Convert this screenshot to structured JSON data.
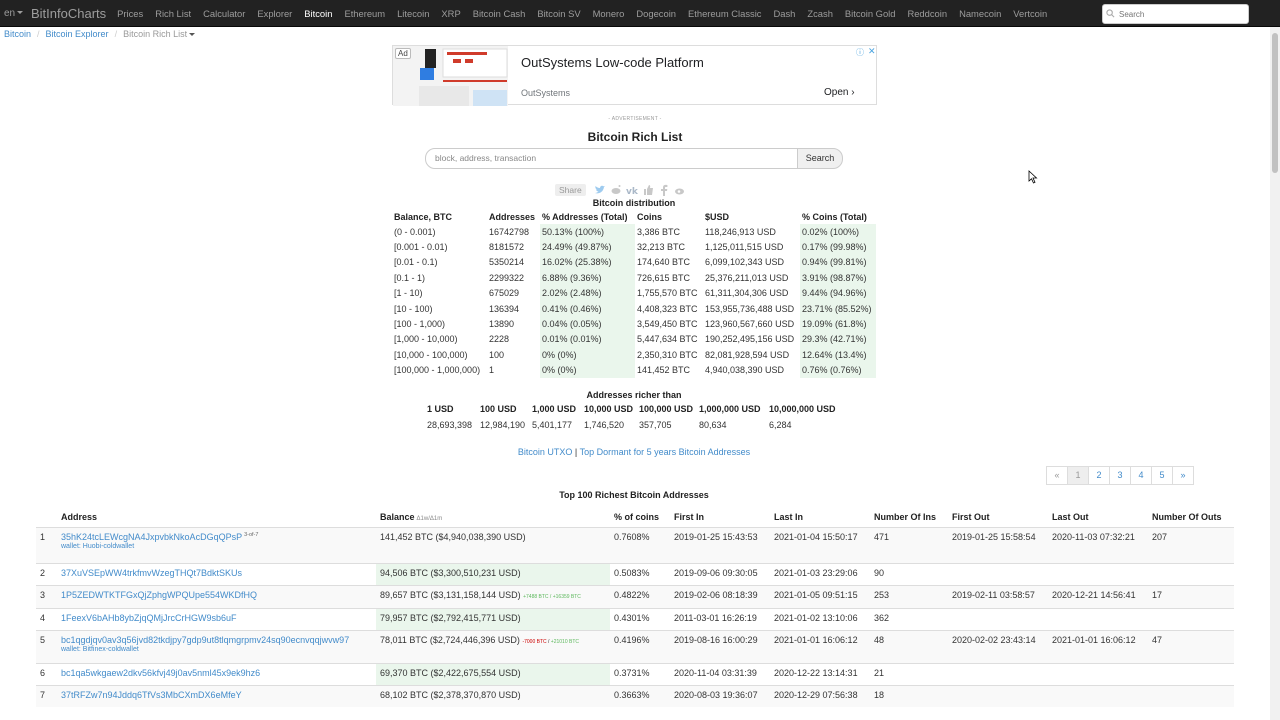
{
  "nav": {
    "lang": "en",
    "brand": "BitInfoCharts",
    "items": [
      {
        "label": "Prices",
        "active": false
      },
      {
        "label": "Rich List",
        "active": false
      },
      {
        "label": "Calculator",
        "active": false
      },
      {
        "label": "Explorer",
        "active": false
      },
      {
        "label": "Bitcoin",
        "active": true
      },
      {
        "label": "Ethereum",
        "active": false
      },
      {
        "label": "Litecoin",
        "active": false
      },
      {
        "label": "XRP",
        "active": false
      },
      {
        "label": "Bitcoin Cash",
        "active": false
      },
      {
        "label": "Bitcoin SV",
        "active": false
      },
      {
        "label": "Monero",
        "active": false
      },
      {
        "label": "Dogecoin",
        "active": false
      },
      {
        "label": "Ethereum Classic",
        "active": false
      },
      {
        "label": "Dash",
        "active": false
      },
      {
        "label": "Zcash",
        "active": false
      },
      {
        "label": "Bitcoin Gold",
        "active": false
      },
      {
        "label": "Reddcoin",
        "active": false
      },
      {
        "label": "Namecoin",
        "active": false
      },
      {
        "label": "Vertcoin",
        "active": false
      }
    ],
    "search_placeholder": "Search"
  },
  "breadcrumb": [
    "Bitcoin",
    "Bitcoin Explorer",
    "Bitcoin Rich List"
  ],
  "ad": {
    "badge": "Ad",
    "title": "OutSystems Low-code Platform",
    "brand": "OutSystems",
    "cta": "Open",
    "caption": "- ADVERTISEMENT -"
  },
  "title": "Bitcoin Rich List",
  "search": {
    "placeholder": "block, address, transaction",
    "button": "Search"
  },
  "share_label": "Share",
  "distribution": {
    "caption": "Bitcoin distribution",
    "headers": [
      "Balance, BTC",
      "Addresses",
      "% Addresses (Total)",
      "Coins",
      "$USD",
      "% Coins (Total)"
    ],
    "rows": [
      [
        "(0 - 0.001)",
        "16742798",
        "50.13% (100%)",
        "3,386 BTC",
        "118,246,913 USD",
        "0.02% (100%)"
      ],
      [
        "[0.001 - 0.01)",
        "8181572",
        "24.49% (49.87%)",
        "32,213 BTC",
        "1,125,011,515 USD",
        "0.17% (99.98%)"
      ],
      [
        "[0.01 - 0.1)",
        "5350214",
        "16.02% (25.38%)",
        "174,640 BTC",
        "6,099,102,343 USD",
        "0.94% (99.81%)"
      ],
      [
        "[0.1 - 1)",
        "2299322",
        "6.88% (9.36%)",
        "726,615 BTC",
        "25,376,211,013 USD",
        "3.91% (98.87%)"
      ],
      [
        "[1 - 10)",
        "675029",
        "2.02% (2.48%)",
        "1,755,570 BTC",
        "61,311,304,306 USD",
        "9.44% (94.96%)"
      ],
      [
        "[10 - 100)",
        "136394",
        "0.41% (0.46%)",
        "4,408,323 BTC",
        "153,955,736,488 USD",
        "23.71% (85.52%)"
      ],
      [
        "[100 - 1,000)",
        "13890",
        "0.04% (0.05%)",
        "3,549,450 BTC",
        "123,960,567,660 USD",
        "19.09% (61.8%)"
      ],
      [
        "[1,000 - 10,000)",
        "2228",
        "0.01% (0.01%)",
        "5,447,634 BTC",
        "190,252,495,156 USD",
        "29.3% (42.71%)"
      ],
      [
        "[10,000 - 100,000)",
        "100",
        "0% (0%)",
        "2,350,310 BTC",
        "82,081,928,594 USD",
        "12.64% (13.4%)"
      ],
      [
        "[100,000 - 1,000,000)",
        "1",
        "0% (0%)",
        "141,452 BTC",
        "4,940,038,390 USD",
        "0.76% (0.76%)"
      ]
    ]
  },
  "richer": {
    "caption": "Addresses richer than",
    "headers": [
      "1 USD",
      "100 USD",
      "1,000 USD",
      "10,000 USD",
      "100,000 USD",
      "1,000,000 USD",
      "10,000,000 USD"
    ],
    "values": [
      "28,693,398",
      "12,984,190",
      "5,401,177",
      "1,746,520",
      "357,705",
      "80,634",
      "6,284"
    ]
  },
  "links": {
    "utxo": "Bitcoin UTXO",
    "sep": "|",
    "dormant": "Top Dormant for 5 years Bitcoin Addresses"
  },
  "pager": [
    "«",
    "1",
    "2",
    "3",
    "4",
    "5",
    "»"
  ],
  "top_caption": "Top 100 Richest Bitcoin Addresses",
  "rich": {
    "headers": [
      "",
      "Address",
      "Balance",
      "% of coins",
      "First In",
      "Last In",
      "Number Of Ins",
      "First Out",
      "Last Out",
      "Number Of Outs"
    ],
    "balance_icons": "Δ1w/Δ1m",
    "rows": [
      {
        "n": "1",
        "address": "35hK24tcLEWcgNA4JxpvbkNkoAcDGqQPsP",
        "sup": "3-of-7",
        "wallet": "wallet: Huobi-coldwallet",
        "balance": "141,452 BTC ($4,940,038,390 USD)",
        "neg": "",
        "pos": "",
        "pct": "0.7608%",
        "first_in": "2019-01-25 15:43:53",
        "last_in": "2021-01-04 15:50:17",
        "ins": "471",
        "first_out": "2019-01-25 15:58:54",
        "last_out": "2020-11-03 07:32:21",
        "outs": "207"
      },
      {
        "n": "2",
        "address": "37XuVSEpWW4trkfmvWzegTHQt7BdktSKUs",
        "sup": "",
        "wallet": "",
        "balance": "94,506 BTC ($3,300,510,231 USD)",
        "neg": "",
        "pos": "",
        "pct": "0.5083%",
        "first_in": "2019-09-06 09:30:05",
        "last_in": "2021-01-03 23:29:06",
        "ins": "90",
        "first_out": "",
        "last_out": "",
        "outs": ""
      },
      {
        "n": "3",
        "address": "1P5ZEDWTKTFGxQjZphgWPQUpe554WKDfHQ",
        "sup": "",
        "wallet": "",
        "balance": "89,657 BTC ($3,131,158,144 USD)",
        "neg": "",
        "pos": "+7488 BTC / +16359 BTC",
        "pct": "0.4822%",
        "first_in": "2019-02-06 08:18:39",
        "last_in": "2021-01-05 09:51:15",
        "ins": "253",
        "first_out": "2019-02-11 03:58:57",
        "last_out": "2020-12-21 14:56:41",
        "outs": "17"
      },
      {
        "n": "4",
        "address": "1FeexV6bAHb8ybZjqQMjJrcCrHGW9sb6uF",
        "sup": "",
        "wallet": "",
        "balance": "79,957 BTC ($2,792,415,771 USD)",
        "neg": "",
        "pos": "",
        "pct": "0.4301%",
        "first_in": "2011-03-01 16:26:19",
        "last_in": "2021-01-02 13:10:06",
        "ins": "362",
        "first_out": "",
        "last_out": "",
        "outs": ""
      },
      {
        "n": "5",
        "address": "bc1qgdjqv0av3q56jvd82tkdjpy7gdp9ut8tlqmgrpmv24sq90ecnvqqjwvw97",
        "sup": "",
        "wallet": "wallet: Bitfinex-coldwallet",
        "balance": "78,011 BTC ($2,724,446,396 USD)",
        "neg": "-7000 BTC",
        "pos": "+21010 BTC",
        "pct": "0.4196%",
        "first_in": "2019-08-16 16:00:29",
        "last_in": "2021-01-01 16:06:12",
        "ins": "48",
        "first_out": "2020-02-02 23:43:14",
        "last_out": "2021-01-01 16:06:12",
        "outs": "47"
      },
      {
        "n": "6",
        "address": "bc1qa5wkgaew2dkv56kfvj49j0av5nml45x9ek9hz6",
        "sup": "",
        "wallet": "",
        "balance": "69,370 BTC ($2,422,675,554 USD)",
        "neg": "",
        "pos": "",
        "pct": "0.3731%",
        "first_in": "2020-11-04 03:31:39",
        "last_in": "2020-12-22 13:14:31",
        "ins": "21",
        "first_out": "",
        "last_out": "",
        "outs": ""
      },
      {
        "n": "7",
        "address": "37tRFZw7n94Jddq6TfVs3MbCXmDX6eMfeY",
        "sup": "",
        "wallet": "",
        "balance": "68,102 BTC ($2,378,370,870 USD)",
        "neg": "",
        "pos": "",
        "pct": "0.3663%",
        "first_in": "2020-08-03 19:36:07",
        "last_in": "2020-12-29 07:56:38",
        "ins": "18",
        "first_out": "",
        "last_out": "",
        "outs": ""
      }
    ]
  },
  "colors": {
    "navbar": "#222222",
    "link": "#428bca",
    "balance_bg": "#eaf6ec",
    "negative": "#cc0000",
    "positive": "#5cb85c"
  }
}
